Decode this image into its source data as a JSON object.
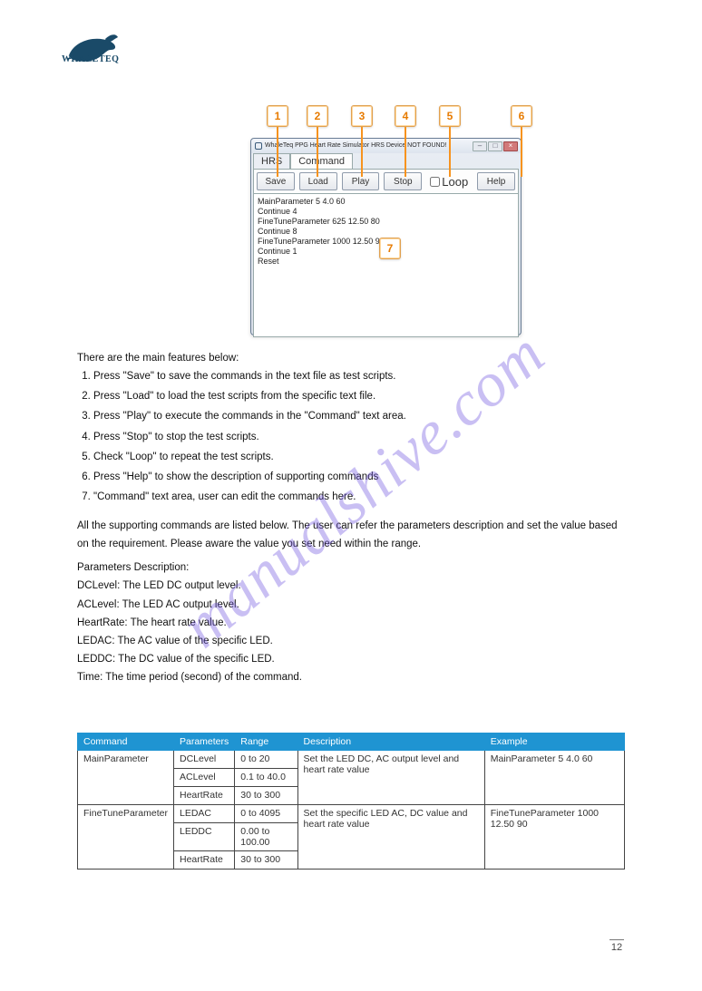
{
  "page_number": "12",
  "watermark": "manualshive.com",
  "logo_text": "WHALETEQ",
  "callouts": {
    "1": "1",
    "2": "2",
    "3": "3",
    "4": "4",
    "5": "5",
    "6": "6",
    "7": "7"
  },
  "app": {
    "title": "WhaleTeq PPG Heart Rate Simulator  HRS Device NOT FOUND!",
    "tabs": {
      "hrs": "HRS",
      "command": "Command"
    },
    "buttons": {
      "save": "Save",
      "load": "Load",
      "play": "Play",
      "stop": "Stop",
      "loop": "Loop",
      "help": "Help"
    },
    "command_text": "MainParameter 5 4.0 60\nContinue 4\nFineTuneParameter 625 12.50 80\nContinue 8\nFineTuneParameter 1000 12.50 9\nContinue 1\nReset"
  },
  "features_heading": "There are the main features below:",
  "features": [
    "Press \"Save\" to save the commands in the text file as test scripts.",
    "Press \"Load\" to load the test scripts from the specific text file.",
    "Press \"Play\" to execute the commands in the \"Command\" text area.",
    "Press \"Stop\" to stop the test scripts.",
    "Check \"Loop\" to repeat the test scripts.",
    "Press \"Help\" to show the description of supporting commands",
    "\"Command\" text area, user can edit the commands here."
  ],
  "intro": "All the supporting commands are listed below. The user can refer the parameters description and set the value based on the requirement. Please aware the value you set need within the range.",
  "params_heading": "Parameters Description:",
  "params": [
    "DCLevel: The LED DC output level.",
    "ACLevel: The LED AC output level.",
    "HeartRate: The heart rate value.",
    "LEDAC: The AC value of the specific LED.",
    "LEDDC: The DC value of the specific LED.",
    "Time: The time period (second) of the command."
  ],
  "table": {
    "headers": [
      "Command",
      "Parameters",
      "Range",
      "Description",
      "Example"
    ],
    "rows": [
      {
        "command": "MainParameter",
        "params": [
          {
            "name": "DCLevel",
            "range": "0 to 20"
          },
          {
            "name": "ACLevel",
            "range": "0.1 to 40.0"
          },
          {
            "name": "HeartRate",
            "range": "30 to 300"
          }
        ],
        "desc": "Set the LED DC, AC output level and heart rate value",
        "example": "MainParameter 5 4.0 60"
      },
      {
        "command": "FineTuneParameter",
        "params": [
          {
            "name": "LEDAC",
            "range": "0 to 4095"
          },
          {
            "name": "LEDDC",
            "range": "0.00 to 100.00"
          },
          {
            "name": "HeartRate",
            "range": "30 to 300"
          }
        ],
        "desc": "Set the specific LED AC, DC value and heart rate value",
        "example": "FineTuneParameter 1000 12.50 90"
      }
    ]
  }
}
